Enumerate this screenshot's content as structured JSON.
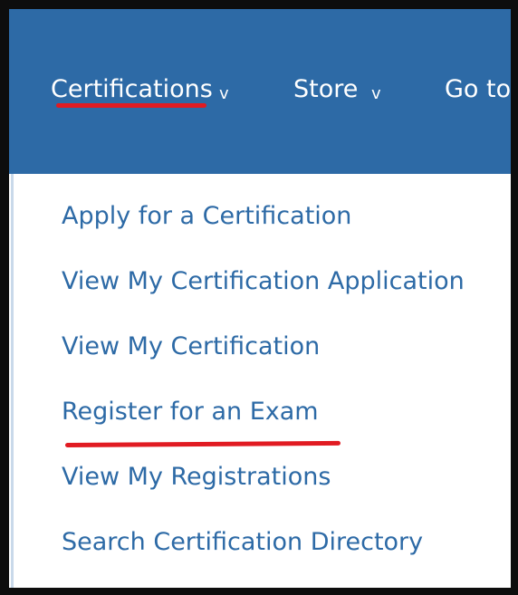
{
  "navbar": {
    "items": [
      {
        "label": "Certifications",
        "caret": "v"
      },
      {
        "label": "Store",
        "caret": "v"
      },
      {
        "label": "Go to"
      }
    ],
    "background": "#2d6aa6"
  },
  "dropdown": {
    "items": [
      {
        "label": "Apply for a Certification"
      },
      {
        "label": "View My Certification Application"
      },
      {
        "label": "View My Certification"
      },
      {
        "label": "Register for an Exam"
      },
      {
        "label": "View My Registrations"
      },
      {
        "label": "Search Certification Directory"
      }
    ]
  },
  "annotations": {
    "highlight_color": "#e11b22"
  }
}
